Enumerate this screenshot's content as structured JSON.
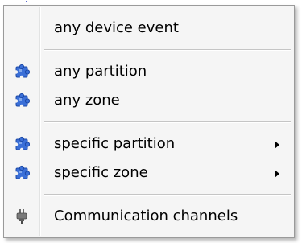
{
  "menu": {
    "items": [
      {
        "label": "any device event",
        "icon": "none",
        "submenu": false
      },
      {
        "label": "any partition",
        "icon": "puzzle-icon",
        "submenu": false
      },
      {
        "label": "any zone",
        "icon": "puzzle-icon",
        "submenu": false
      },
      {
        "label": "specific partition",
        "icon": "puzzle-icon",
        "submenu": true
      },
      {
        "label": "specific zone",
        "icon": "puzzle-icon",
        "submenu": true
      },
      {
        "label": "Communication channels",
        "icon": "plug-icon",
        "submenu": false
      }
    ]
  },
  "colors": {
    "menu_background": "#f5f5f5",
    "puzzle_icon": "#3a6fd8",
    "plug_icon": "#6b6b6b"
  }
}
